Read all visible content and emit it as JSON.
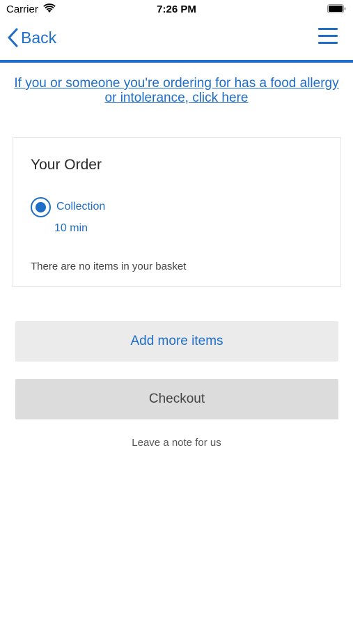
{
  "status_bar": {
    "carrier": "Carrier",
    "time": "7:26 PM"
  },
  "nav": {
    "back_label": "Back"
  },
  "allergy_link": "If you or someone you're ordering for has a food allergy or intolerance, click here",
  "order": {
    "title": "Your Order",
    "collection_label": "Collection",
    "collection_time": "10 min",
    "empty_message": "There are no items in your basket"
  },
  "buttons": {
    "add_more": "Add more items",
    "checkout": "Checkout"
  },
  "note_link": "Leave a note for us",
  "colors": {
    "accent": "#1e6ec8",
    "button_light": "#ebebeb",
    "button_dark": "#dcdcdc"
  },
  "icons": {
    "wifi": "wifi-icon",
    "battery": "battery-icon",
    "back": "chevron-left-icon",
    "menu": "hamburger-menu-icon"
  }
}
